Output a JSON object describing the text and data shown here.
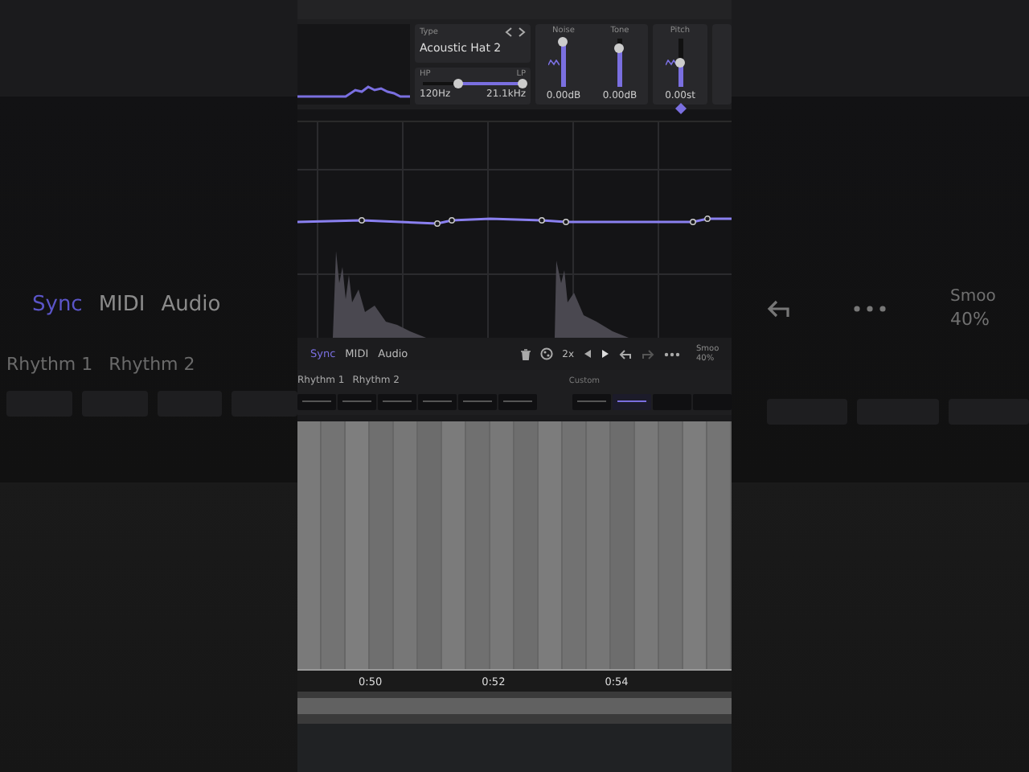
{
  "backdrop": {
    "modes": [
      {
        "label": "Sync",
        "selected": true
      },
      {
        "label": "MIDI",
        "selected": false
      },
      {
        "label": "Audio",
        "selected": false
      }
    ],
    "patterns": [
      "Rhythm 1",
      "Rhythm 2"
    ],
    "smooth_label": "Smoo",
    "smooth_value": "40%"
  },
  "sample": {
    "type_label": "Type",
    "type_value": "Acoustic Hat 2",
    "filter": [
      {
        "label": "HP",
        "level": 0.35,
        "value": "120Hz"
      },
      {
        "label": "LP",
        "level": 1,
        "value": "21.1kHz"
      }
    ],
    "faders": [
      {
        "label": "Noise",
        "level": 0.95,
        "reading": "0.00dB",
        "wave": true,
        "marker": false
      },
      {
        "label": "Tone",
        "level": 0.8,
        "reading": "0.00dB",
        "wave": false,
        "marker": false
      },
      {
        "label": "Pitch",
        "level": 0.5,
        "reading": "0.00st",
        "wave": true,
        "marker": true
      }
    ]
  },
  "toolbar": {
    "modes": [
      {
        "label": "Sync",
        "selected": true
      },
      {
        "label": "MIDI",
        "selected": false
      },
      {
        "label": "Audio",
        "selected": false
      }
    ],
    "rate": "2x",
    "smooth_label": "Smoo",
    "smooth_value": "40%"
  },
  "patterns": {
    "tabs": [
      "Rhythm 1",
      "Rhythm 2"
    ],
    "pads": [
      {
        "selected": false
      },
      {
        "selected": false
      },
      {
        "selected": false
      },
      {
        "selected": false
      },
      {
        "selected": false
      },
      {
        "selected": false
      }
    ],
    "custom_label": "Custom",
    "custom_pads": [
      {
        "selected": false
      },
      {
        "selected": true
      },
      {
        "selected": false
      },
      {
        "selected": false
      }
    ]
  },
  "timeline": {
    "times": [
      "0:50",
      "0:52",
      "0:54"
    ]
  }
}
